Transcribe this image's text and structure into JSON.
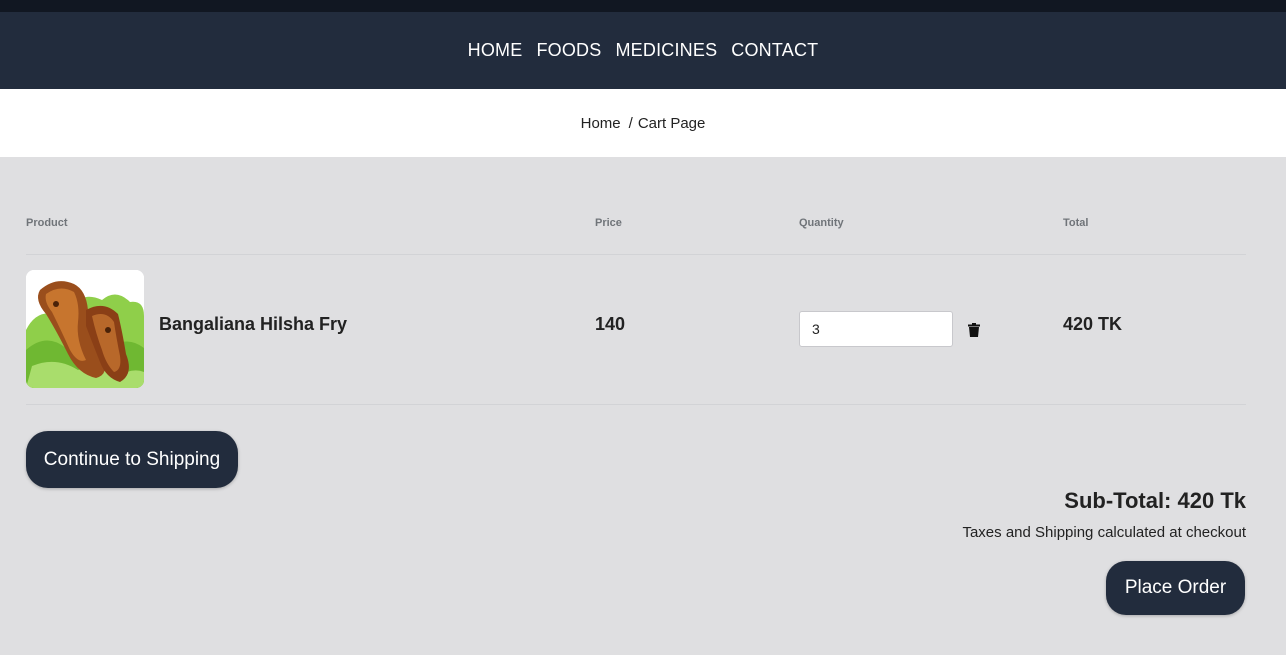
{
  "nav": {
    "items": [
      "HOME",
      "FOODS",
      "MEDICINES",
      "CONTACT"
    ]
  },
  "breadcrumb": {
    "home": "Home",
    "separator": "/",
    "current": "Cart Page"
  },
  "cart": {
    "headers": {
      "product": "Product",
      "price": "Price",
      "quantity": "Quantity",
      "total": "Total"
    },
    "items": [
      {
        "name": "Bangaliana Hilsha Fry",
        "price": "140",
        "quantity": "3",
        "total": "420 TK",
        "image_icon": "hilsha-fry-photo"
      }
    ]
  },
  "actions": {
    "continue_label": "Continue to Shipping",
    "place_order_label": "Place Order"
  },
  "summary": {
    "subtotal": "Sub-Total: 420 Tk",
    "note": "Taxes and Shipping calculated at checkout"
  },
  "colors": {
    "nav_bg": "#222c3d",
    "top_strip": "#111722",
    "page_bg": "#dfdfe1",
    "button_bg": "#222c3d"
  }
}
